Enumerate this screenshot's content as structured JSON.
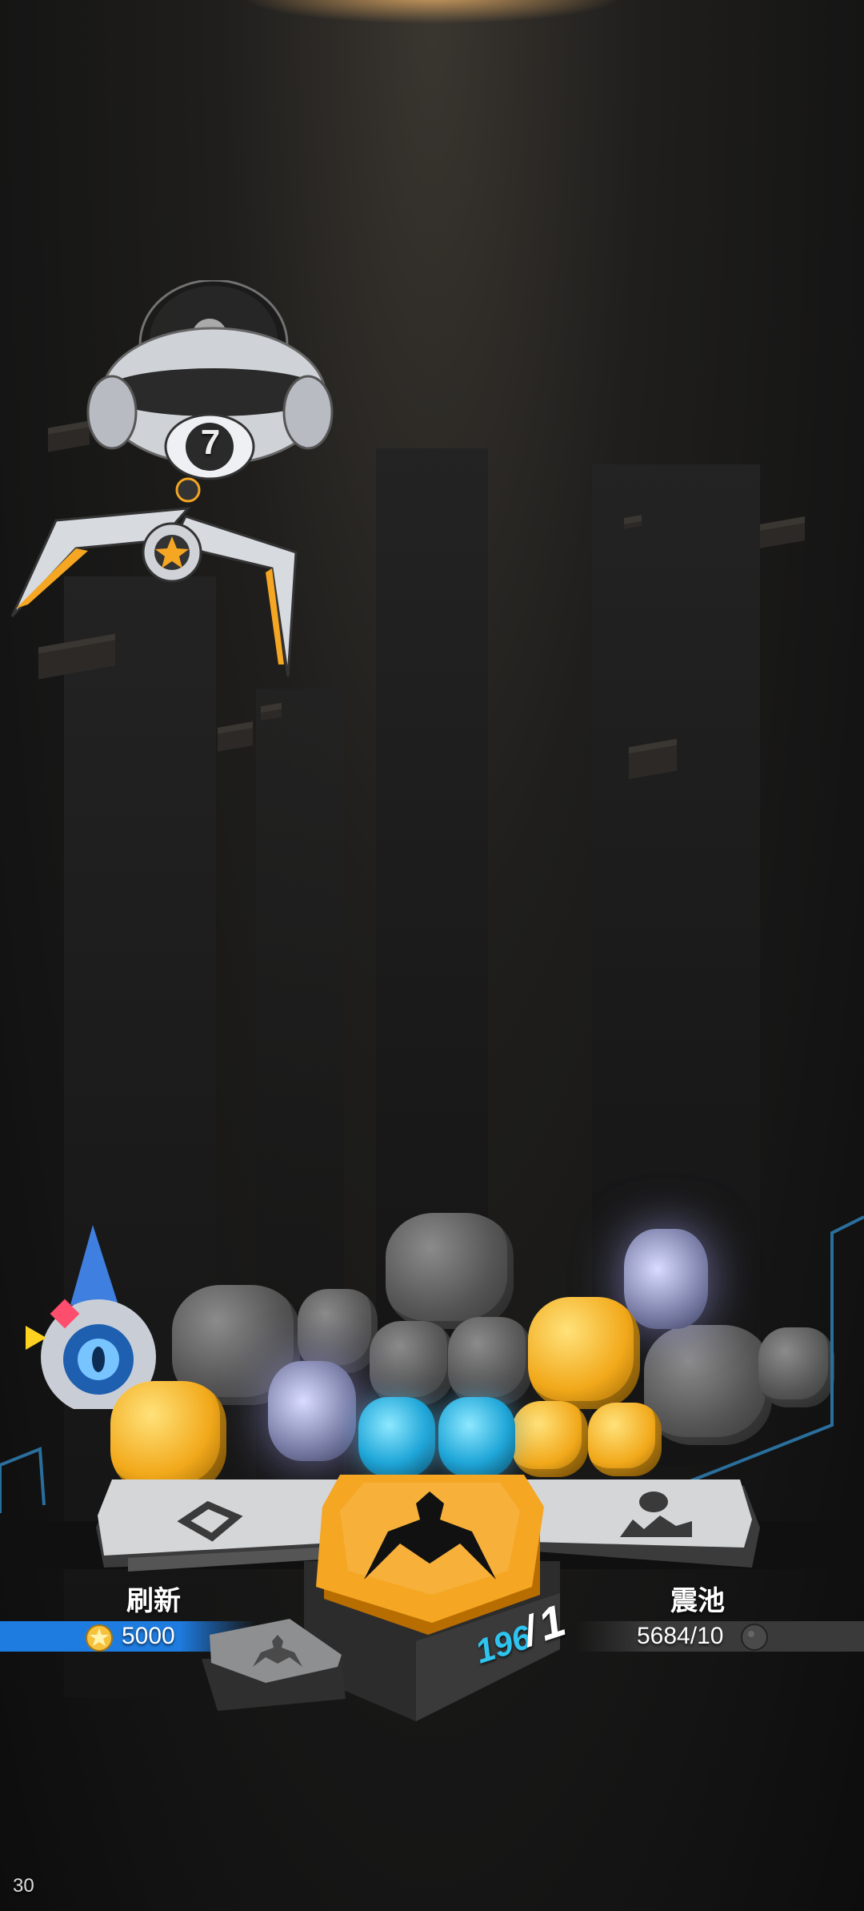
{
  "claw_machine": {
    "badge_number": "7"
  },
  "controls": {
    "refresh": {
      "label": "刷新",
      "cost": "5000"
    },
    "pool": {
      "label": "震池",
      "count": "5684/10"
    },
    "grab": {
      "attempts_left": "196",
      "attempts_sep": "/",
      "attempts_cost": "1"
    }
  },
  "status": {
    "fps": "30"
  },
  "colors": {
    "accent_orange": "#f5a623",
    "bar_blue": "#1e7ce0",
    "attempt_cyan": "#2fc4f0"
  }
}
